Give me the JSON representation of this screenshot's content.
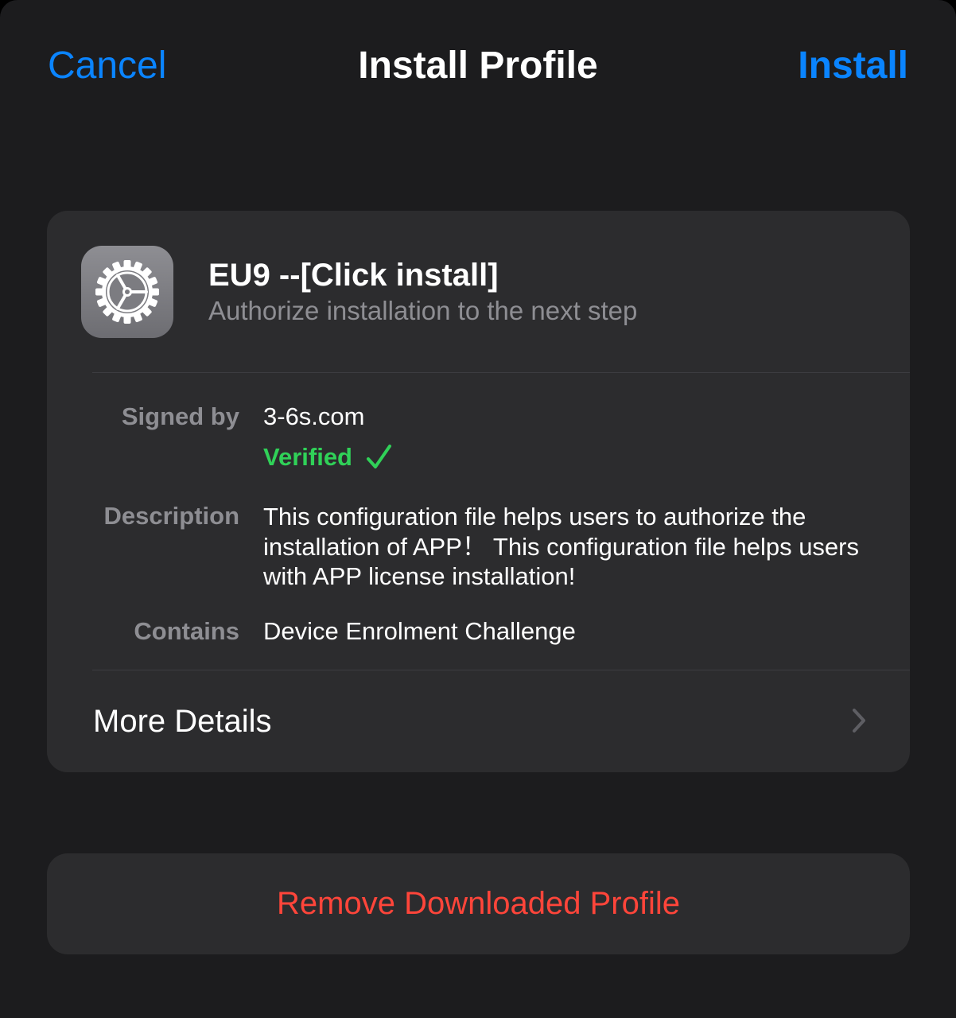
{
  "nav": {
    "cancel_label": "Cancel",
    "title": "Install Profile",
    "install_label": "Install"
  },
  "profile": {
    "icon": "settings-gear-icon",
    "name": "EU9 --[Click install]",
    "subtitle": "Authorize installation to the next step"
  },
  "details": {
    "signed_by_label": "Signed by",
    "signed_by_value": "3-6s.com",
    "verified_label": "Verified",
    "verified_icon": "checkmark-icon",
    "description_label": "Description",
    "description_value": "This configuration file helps users to authorize the installation of APP！ This configuration file helps users with APP license installation!",
    "contains_label": "Contains",
    "contains_value": "Device Enrolment Challenge"
  },
  "more_details": {
    "label": "More Details",
    "icon": "chevron-right-icon"
  },
  "remove": {
    "label": "Remove Downloaded Profile"
  },
  "colors": {
    "background": "#1c1c1e",
    "card": "#2c2c2e",
    "accent_blue": "#0a84ff",
    "verified_green": "#30d158",
    "destructive_red": "#ff453a",
    "secondary_text": "#8e8e93"
  }
}
